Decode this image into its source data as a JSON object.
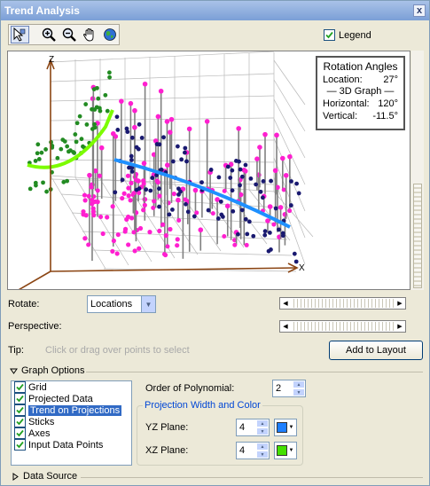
{
  "window": {
    "title": "Trend Analysis",
    "close_label": "x"
  },
  "toolbar": {
    "icons": [
      "select-pointer-icon",
      "zoom-in-icon",
      "zoom-out-icon",
      "pan-hand-icon",
      "full-extent-globe-icon"
    ]
  },
  "legend": {
    "label": "Legend",
    "checked": true
  },
  "graph": {
    "axis_z": "Z",
    "axis_x": "X",
    "rotation": {
      "title": "Rotation Angles",
      "location_label": "Location:",
      "location_value": "27°",
      "graph_label": "3D Graph",
      "horizontal_label": "Horizontal:",
      "horizontal_value": "120°",
      "vertical_label": "Vertical:",
      "vertical_value": "-11.5°"
    },
    "colors": {
      "yz_trend": "#7cfc00",
      "xz_trend": "#1e90ff",
      "yz_points": "#228b22",
      "xz_points": "#191970",
      "data_points": "#ff1fd0",
      "sticks": "#808080",
      "axes": "#8b4513"
    }
  },
  "controls": {
    "rotate_label": "Rotate:",
    "rotate_value": "Locations",
    "perspective_label": "Perspective:",
    "tip_label": "Tip:",
    "tip_text": "Click or drag over points to select",
    "add_button": "Add to Layout"
  },
  "graph_options": {
    "title": "Graph Options",
    "items": [
      {
        "label": "Grid",
        "checked": true,
        "selected": false
      },
      {
        "label": "Projected Data",
        "checked": true,
        "selected": false
      },
      {
        "label": "Trend on Projections",
        "checked": true,
        "selected": true
      },
      {
        "label": "Sticks",
        "checked": true,
        "selected": false
      },
      {
        "label": "Axes",
        "checked": true,
        "selected": false
      },
      {
        "label": "Input Data Points",
        "checked": true,
        "selected": false
      }
    ],
    "order_label": "Order of Polynomial:",
    "order_value": "2",
    "projection_title": "Projection Width and Color",
    "yz_label": "YZ Plane:",
    "yz_width": "4",
    "yz_color": "#1e7fff",
    "xz_label": "XZ Plane:",
    "xz_width": "4",
    "xz_color": "#44e000"
  },
  "data_source": {
    "title": "Data Source"
  }
}
